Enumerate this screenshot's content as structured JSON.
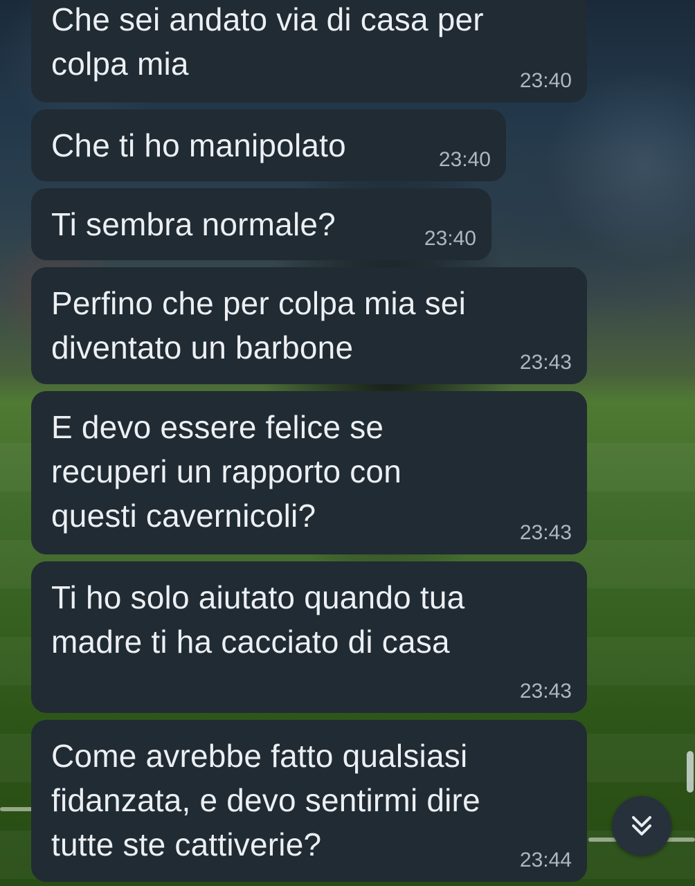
{
  "chat": {
    "messages": [
      {
        "text": "Che sei andato via di casa per\ncolpa mia",
        "time": "23:40"
      },
      {
        "text": "Che ti ho manipolato",
        "time": "23:40"
      },
      {
        "text": "Ti sembra normale?",
        "time": "23:40"
      },
      {
        "text": "Perfino che per colpa mia sei\ndiventato un barbone",
        "time": "23:43"
      },
      {
        "text": "E devo essere felice se\nrecuperi un rapporto con\nquesti cavernicoli?",
        "time": "23:43"
      },
      {
        "text": "Ti ho solo aiutato quando tua\nmadre ti ha cacciato di casa",
        "time": "23:43"
      },
      {
        "text": "Come avrebbe fatto qualsiasi\nfidanzata, e devo sentirmi dire\ntutte ste cattiverie?",
        "time": "23:44"
      }
    ]
  },
  "scroll_down_button": {
    "icon": "double-chevron-down-icon"
  },
  "colors": {
    "bubble_background": "#212b34",
    "message_text": "#ecf0f3",
    "time_text": "#aeb8c0"
  }
}
